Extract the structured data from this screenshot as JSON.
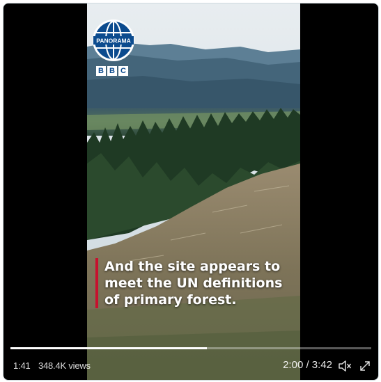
{
  "video": {
    "brand": {
      "logo_text": "PANORAMA",
      "bbc_letters": [
        "B",
        "B",
        "C"
      ]
    },
    "caption_lines": [
      "And the site appears to",
      "meet the UN definitions",
      "of primary forest."
    ],
    "colors": {
      "caption_bar": "#c8102e",
      "logo_blue": "#0c4b8e"
    }
  },
  "player": {
    "progress_fraction": 0.545,
    "elapsed_short": "1:41",
    "views": "348.4K views",
    "time_display": "2:00 / 3:42",
    "icons": [
      "volume-muted-icon",
      "expand-icon"
    ]
  }
}
